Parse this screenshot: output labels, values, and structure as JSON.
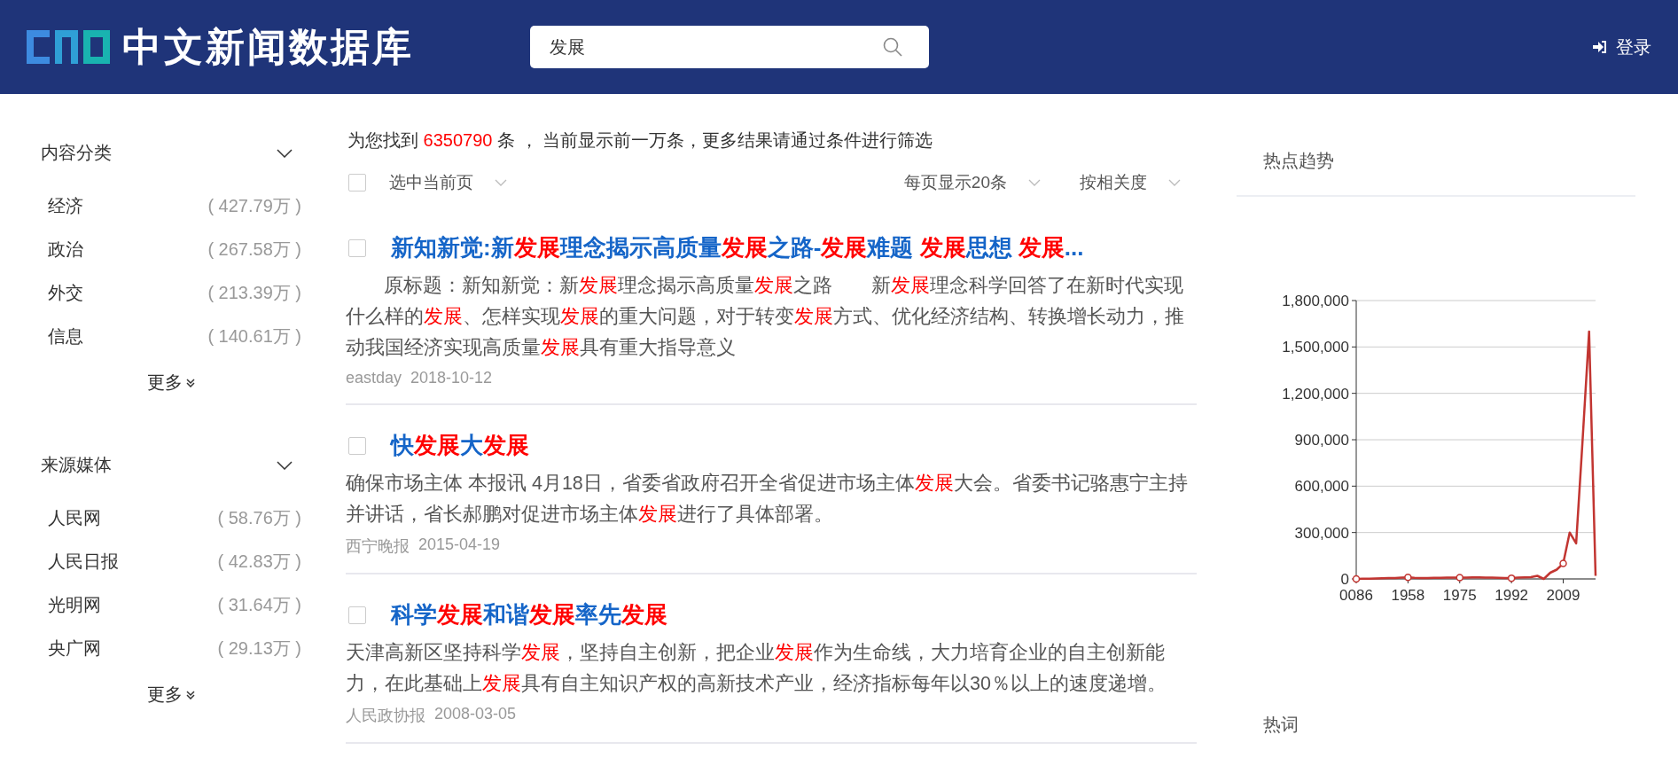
{
  "header": {
    "site_title": "中文新闻数据库",
    "search": {
      "value": "发展"
    },
    "login": "登录"
  },
  "sidebar": {
    "groups": [
      {
        "title": "内容分类",
        "expanded": true,
        "items": [
          {
            "name": "经济",
            "count": "( 427.79万 )"
          },
          {
            "name": "政治",
            "count": "( 267.58万 )"
          },
          {
            "name": "外交",
            "count": "( 213.39万 )"
          },
          {
            "name": "信息",
            "count": "( 140.61万 )"
          }
        ],
        "more": "更多"
      },
      {
        "title": "来源媒体",
        "expanded": true,
        "items": [
          {
            "name": "人民网",
            "count": "( 58.76万 )"
          },
          {
            "name": "人民日报",
            "count": "( 42.83万 )"
          },
          {
            "name": "光明网",
            "count": "( 31.64万 )"
          },
          {
            "name": "央广网",
            "count": "( 29.13万 )"
          }
        ],
        "more": "更多"
      }
    ]
  },
  "results_summary": {
    "before": "为您找到",
    "count": "6350790",
    "after": "条 ， 当前显示前一万条，更多结果请通过条件进行筛选"
  },
  "toolbar": {
    "select_page": {
      "label": "选中当前页",
      "checked": false
    },
    "page_size": "每页显示20条",
    "sort": "按相关度"
  },
  "results": [
    {
      "checked": false,
      "title": [
        {
          "text": "新知新觉:新",
          "hl": false
        },
        {
          "text": "发展",
          "hl": true
        },
        {
          "text": "理念揭示高质量",
          "hl": false
        },
        {
          "text": "发展",
          "hl": true
        },
        {
          "text": "之路-",
          "hl": false
        },
        {
          "text": "发展",
          "hl": true
        },
        {
          "text": "难题 ",
          "hl": false
        },
        {
          "text": "发展",
          "hl": true
        },
        {
          "text": "思想 ",
          "hl": false
        },
        {
          "text": "发展",
          "hl": true
        },
        {
          "text": "...",
          "hl": false
        }
      ],
      "indent": true,
      "snippet": [
        {
          "text": "原标题：新知新觉：新",
          "hl": false
        },
        {
          "text": "发展",
          "hl": true
        },
        {
          "text": "理念揭示高质量",
          "hl": false
        },
        {
          "text": "发展",
          "hl": true
        },
        {
          "text": "之路　　新",
          "hl": false
        },
        {
          "text": "发展",
          "hl": true
        },
        {
          "text": "理念科学回答了在新时代实现什么样的",
          "hl": false
        },
        {
          "text": "发展",
          "hl": true
        },
        {
          "text": "、怎样实现",
          "hl": false
        },
        {
          "text": "发展",
          "hl": true
        },
        {
          "text": "的重大问题，对于转变",
          "hl": false
        },
        {
          "text": "发展",
          "hl": true
        },
        {
          "text": "方式、优化经济结构、转换增长动力，推动我国经济实现高质量",
          "hl": false
        },
        {
          "text": "发展",
          "hl": true
        },
        {
          "text": "具有重大指导意义",
          "hl": false
        }
      ],
      "source": "eastday",
      "date": "2018-10-12"
    },
    {
      "checked": false,
      "title": [
        {
          "text": "快",
          "hl": false
        },
        {
          "text": "发展",
          "hl": true
        },
        {
          "text": "大",
          "hl": false
        },
        {
          "text": "发展",
          "hl": true
        }
      ],
      "indent": false,
      "snippet": [
        {
          "text": "确保市场主体 本报讯 4月18日，省委省政府召开全省促进市场主体",
          "hl": false
        },
        {
          "text": "发展",
          "hl": true
        },
        {
          "text": "大会。省委书记骆惠宁主持并讲话，省长郝鹏对促进市场主体",
          "hl": false
        },
        {
          "text": "发展",
          "hl": true
        },
        {
          "text": "进行了具体部署。",
          "hl": false
        }
      ],
      "source": "西宁晚报",
      "date": "2015-04-19"
    },
    {
      "checked": false,
      "title": [
        {
          "text": "科学",
          "hl": false
        },
        {
          "text": "发展",
          "hl": true
        },
        {
          "text": "和谐",
          "hl": false
        },
        {
          "text": "发展",
          "hl": true
        },
        {
          "text": "率先",
          "hl": false
        },
        {
          "text": "发展",
          "hl": true
        }
      ],
      "indent": false,
      "snippet": [
        {
          "text": "天津高新区坚持科学",
          "hl": false
        },
        {
          "text": "发展",
          "hl": true
        },
        {
          "text": "，坚持自主创新，把企业",
          "hl": false
        },
        {
          "text": "发展",
          "hl": true
        },
        {
          "text": "作为生命线，大力培育企业的自主创新能力，在此基础上",
          "hl": false
        },
        {
          "text": "发展",
          "hl": true
        },
        {
          "text": "具有自主知识产权的高新技术产业，经济指标每年以30％以上的速度递增。",
          "hl": false
        }
      ],
      "source": "人民政协报",
      "date": "2008-03-05"
    }
  ],
  "trend": {
    "title": "热点趋势",
    "chart_data": {
      "type": "line",
      "categories": [
        "0086",
        null,
        null,
        null,
        null,
        null,
        null,
        null,
        "1958",
        null,
        null,
        null,
        null,
        null,
        null,
        null,
        "1975",
        null,
        null,
        null,
        null,
        null,
        null,
        null,
        "1992",
        null,
        null,
        null,
        null,
        null,
        null,
        null,
        "2009",
        null,
        null,
        null,
        null,
        null
      ],
      "series": [
        {
          "color": "#c23531",
          "values": [
            0,
            1000,
            2000,
            3000,
            4000,
            5000,
            6000,
            8000,
            10000,
            7000,
            6000,
            6000,
            7000,
            7000,
            8000,
            8000,
            8000,
            9000,
            10000,
            10000,
            9000,
            8000,
            7000,
            6000,
            5000,
            8000,
            10000,
            12000,
            20000,
            0,
            40000,
            60000,
            100000,
            300000,
            230000,
            900000,
            1600000,
            20000
          ]
        }
      ],
      "ylim": [
        0,
        1800000
      ],
      "grid": true,
      "yticks": [
        {
          "value": 0,
          "label": "0"
        },
        {
          "value": 300000,
          "label": "300,000"
        },
        {
          "value": 600000,
          "label": "600,000"
        },
        {
          "value": 900000,
          "label": "900,000"
        },
        {
          "value": 1200000,
          "label": "1,200,000"
        },
        {
          "value": 1500000,
          "label": "1,500,000"
        },
        {
          "value": 1800000,
          "label": "1,800,000"
        }
      ]
    }
  },
  "hot_words": {
    "title": "热词"
  }
}
